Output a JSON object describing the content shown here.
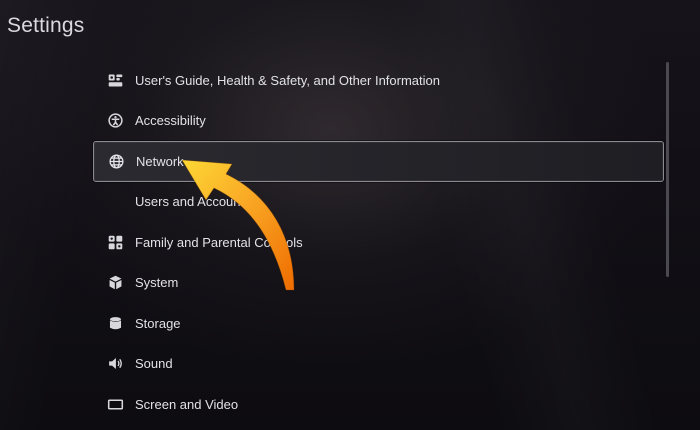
{
  "page": {
    "title": "Settings"
  },
  "menu": {
    "items": [
      {
        "label": "User's Guide, Health & Safety, and Other Information",
        "icon": "users-guide-icon"
      },
      {
        "label": "Accessibility",
        "icon": "accessibility-icon"
      },
      {
        "label": "Network",
        "icon": "globe-icon",
        "selected": true
      },
      {
        "label": "Users and Accounts",
        "icon": "users-accounts-icon"
      },
      {
        "label": "Family and Parental Controls",
        "icon": "family-controls-icon"
      },
      {
        "label": "System",
        "icon": "cube-icon"
      },
      {
        "label": "Storage",
        "icon": "storage-icon"
      },
      {
        "label": "Sound",
        "icon": "speaker-icon"
      },
      {
        "label": "Screen and Video",
        "icon": "screen-icon"
      }
    ]
  },
  "colors": {
    "arrow_orange": "#f28c1e",
    "arrow_yellow": "#fbc02d",
    "selected_border": "#8a8a90"
  }
}
